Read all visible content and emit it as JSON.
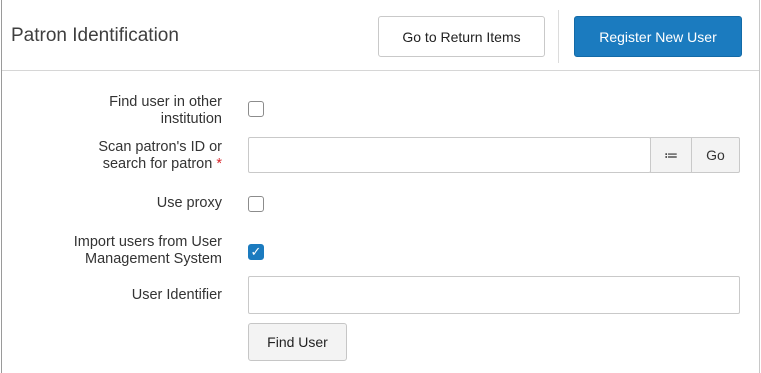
{
  "header": {
    "title": "Patron Identification",
    "return_items_label": "Go to Return Items",
    "register_label": "Register New User"
  },
  "form": {
    "find_other_institution_label": "Find user in other institution",
    "find_other_institution_checked": false,
    "scan_label_line1": "Scan patron's ID or",
    "scan_label_line2": "search for patron",
    "required_mark": "*",
    "scan_value": "",
    "list_icon": "≔",
    "go_label": "Go",
    "use_proxy_label": "Use proxy",
    "use_proxy_checked": false,
    "import_label_line1": "Import users from User",
    "import_label_line2": "Management System",
    "import_checked": true,
    "check_mark": "✓",
    "user_identifier_label": "User Identifier",
    "user_identifier_value": "",
    "find_user_label": "Find User"
  }
}
